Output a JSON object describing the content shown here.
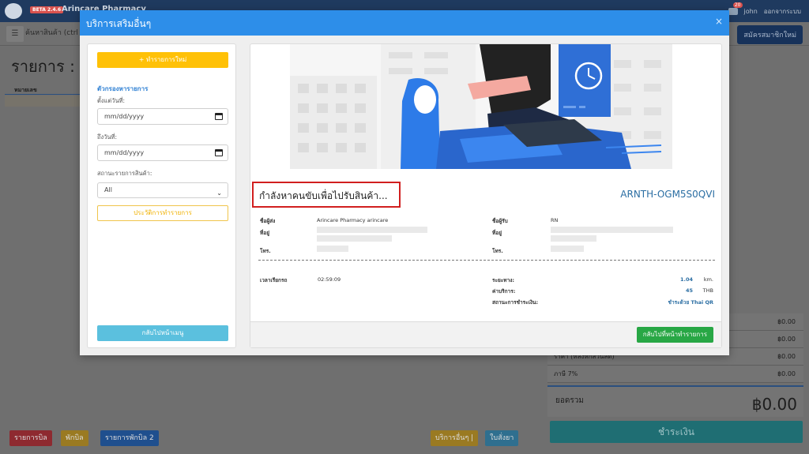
{
  "app": {
    "beta_badge": "BETA 2.4.6",
    "title": "Arincare Pharmacy",
    "user": "john",
    "logout": "ออกจากระบบ",
    "notification_count": "20",
    "product_search": "ค้นหาสินค้า (ctrl + ...",
    "member_button": "สมัครสมาชิกใหม่",
    "page_heading": "รายการ : S",
    "column_header": "หมายเลข",
    "summary_rows": [
      {
        "label": "",
        "value": "฿0.00"
      },
      {
        "label": "",
        "value": "฿0.00"
      },
      {
        "label": "ราคา (หลังหักส่วนลด)",
        "value": "฿0.00"
      },
      {
        "label": "ภาษี 7%",
        "value": "฿0.00"
      }
    ],
    "total_label": "ยอดรวม",
    "total_value": "฿0.00",
    "pay_button": "ชำระเงิน",
    "footer_buttons": {
      "bill_list": "รายการบิล",
      "hold_bill": "พักบิล",
      "held_bill_list": "รายการพักบิล 2",
      "other_services": "บริการอื่นๆ |",
      "forward": "ใบสั่งยา"
    }
  },
  "modal": {
    "title": "บริการเสริมอื่นๆ",
    "close": "×",
    "sidebar": {
      "new_order_button": "+ ทำรายการใหม่",
      "filter_title": "ตัวกรองหารายการ",
      "from_date_label": "ตั้งแต่วันที่:",
      "from_date_placeholder": "mm/dd/yyyy",
      "to_date_label": "ถึงวันที่:",
      "to_date_placeholder": "mm/dd/yyyy",
      "status_label": "สถานะรายการสินค้า:",
      "status_value": "All",
      "history_button": "ประวัติการทำรายการ",
      "back_menu_button": "กลับไปหน้าเมนู"
    },
    "order": {
      "status": "กำลังหาคนขับเพื่อไปรับสินค้า...",
      "order_id": "ARNTH-OGM5S0QVI",
      "sender_name_label": "ชื่อผู้ส่ง",
      "sender_name": "Arincare Pharmacy arincare",
      "sender_address_label": "ที่อยู่",
      "sender_phone_label": "โทร.",
      "receiver_name_label": "ชื่อผู้รับ",
      "receiver_name": "RN",
      "receiver_address_label": "ที่อยู่",
      "receiver_phone_label": "โทร.",
      "call_time_label": "เวลาเรียกรถ",
      "call_time": "02:59:09",
      "distance_label": "ระยะทาง:",
      "distance_value": "1.04",
      "distance_unit": "km.",
      "fee_label": "ค่าบริการ:",
      "fee_value": "45",
      "fee_unit": "THB",
      "payment_label": "สถานะการชำระเงิน:",
      "payment_value": "ชำระด้วย Thai QR"
    },
    "back_to_orders_button": "กลับไปที่หน้าทำรายการ"
  }
}
